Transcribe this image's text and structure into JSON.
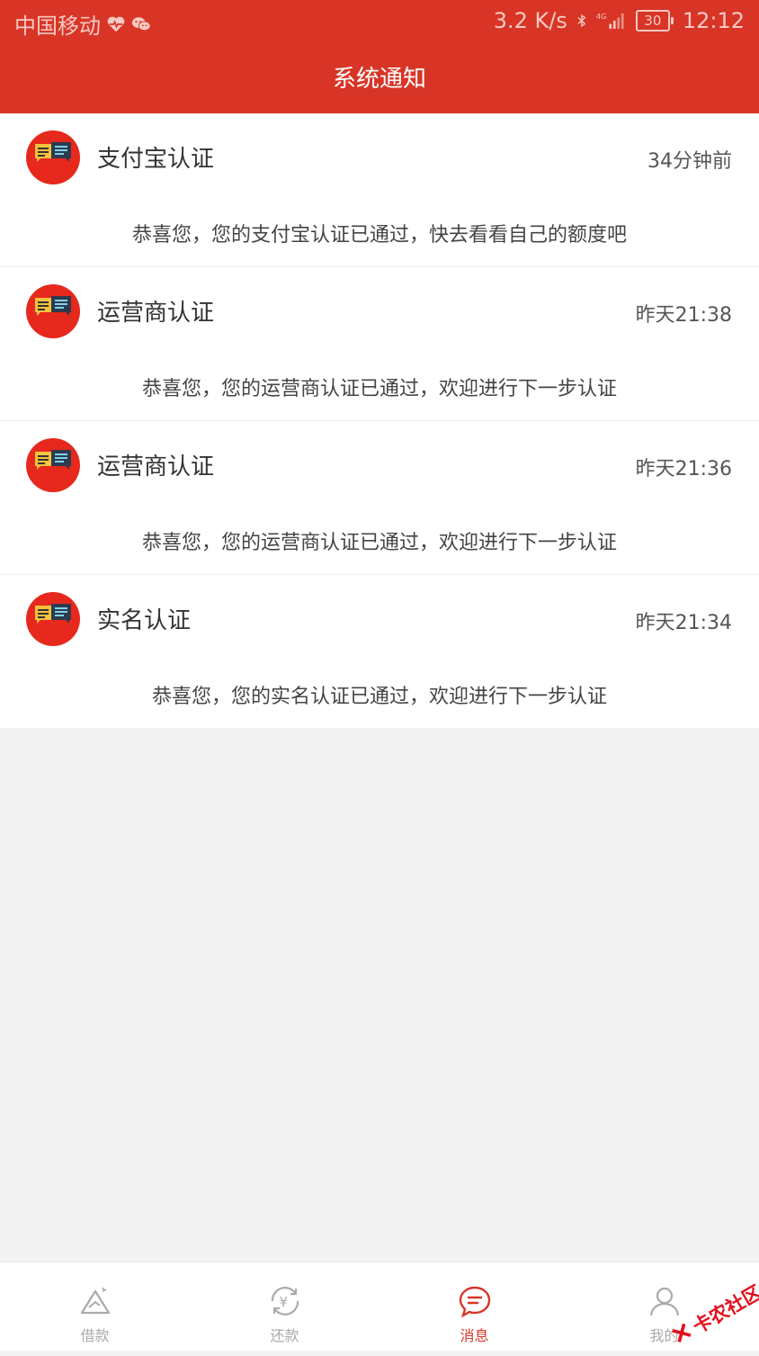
{
  "status_bar": {
    "carrier": "中国移动",
    "speed": "3.2 K/s",
    "battery": "30",
    "time": "12:12",
    "icons": [
      "heart-pulse-icon",
      "wechat-icon",
      "bluetooth-icon",
      "4g-signal-icon"
    ]
  },
  "header": {
    "title": "系统通知"
  },
  "notifications": [
    {
      "title": "支付宝认证",
      "time": "34分钟前",
      "body": "恭喜您，您的支付宝认证已通过，快去看看自己的额度吧"
    },
    {
      "title": "运营商认证",
      "time": "昨天21:38",
      "body": "恭喜您，您的运营商认证已通过，欢迎进行下一步认证"
    },
    {
      "title": "运营商认证",
      "time": "昨天21:36",
      "body": "恭喜您，您的运营商认证已通过，欢迎进行下一步认证"
    },
    {
      "title": "实名认证",
      "time": "昨天21:34",
      "body": "恭喜您，您的实名认证已通过，欢迎进行下一步认证"
    }
  ],
  "bottom_nav": {
    "tabs": [
      {
        "label": "借款",
        "icon": "loan-icon"
      },
      {
        "label": "还款",
        "icon": "repay-icon"
      },
      {
        "label": "消息",
        "icon": "message-icon",
        "active": true
      },
      {
        "label": "我的",
        "icon": "profile-icon"
      }
    ]
  },
  "watermark": {
    "text": "卡农社区"
  },
  "colors": {
    "brand": "#d83526",
    "avatar": "#e7281c",
    "inactive": "#aaaaaa"
  }
}
